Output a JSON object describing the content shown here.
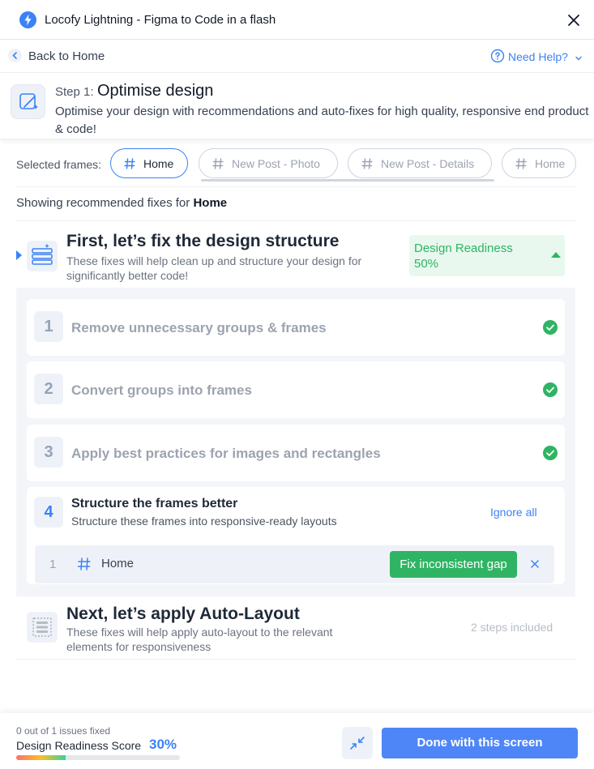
{
  "window": {
    "title": "Locofy Lightning - Figma to Code in a flash"
  },
  "nav": {
    "back_label": "Back to Home",
    "help_label": "Need Help?"
  },
  "step": {
    "label": "Step 1:",
    "title": "Optimise design",
    "description": "Optimise your design with recommendations and auto-fixes for high quality, responsive end product & code!"
  },
  "frames": {
    "label": "Selected frames:",
    "items": [
      "Home",
      "New Post - Photo",
      "New Post - Details",
      "Home"
    ],
    "selected": "Home"
  },
  "showing": {
    "prefix": "Showing recommended fixes for",
    "frame": "Home"
  },
  "structure_section": {
    "title": "First, let’s fix the design structure",
    "description": "These fixes will help clean up and structure your design for significantly better code!",
    "readiness_label": "Design Readiness 50%",
    "fixes": [
      {
        "number": "1",
        "title": "Remove unnecessary groups & frames",
        "status": "done"
      },
      {
        "number": "2",
        "title": "Convert groups into frames",
        "status": "done"
      },
      {
        "number": "3",
        "title": "Apply best practices for images and rectangles",
        "status": "done"
      },
      {
        "number": "4",
        "title": "Structure the frames better",
        "subtitle": "Structure these frames into responsive-ready layouts",
        "ignore_label": "Ignore all",
        "issues": [
          {
            "index": "1",
            "frame": "Home",
            "action": "Fix inconsistent gap"
          }
        ]
      }
    ]
  },
  "autolayout_section": {
    "title": "Next, let’s apply Auto-Layout",
    "description": "These fixes will help apply auto-layout to the relevant elements for responsiveness",
    "steps_label": "2 steps included"
  },
  "footer": {
    "issues_label": "0 out of 1 issues fixed",
    "score_label": "Design Readiness Score",
    "score_value": "30%",
    "score_fraction": 0.3,
    "done_label": "Done with this screen"
  },
  "colors": {
    "accent": "#3b82f6",
    "success": "#2fb463",
    "primary_button": "#4f86f7"
  }
}
